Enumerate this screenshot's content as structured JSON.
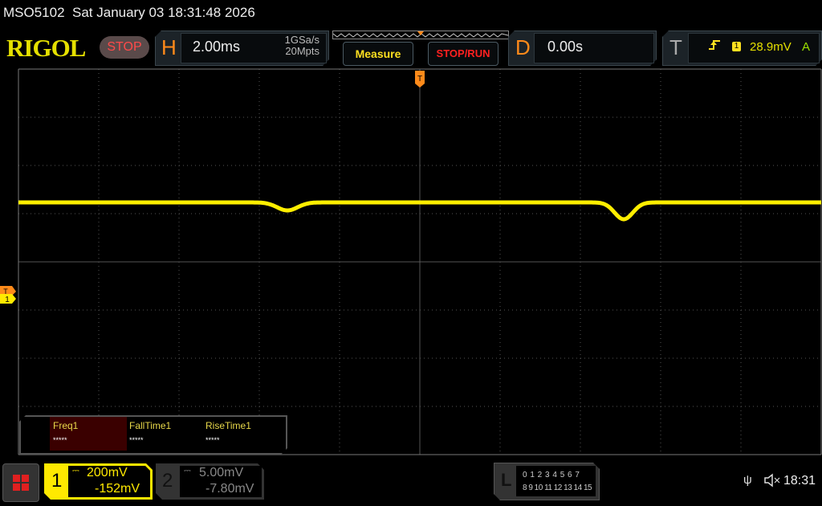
{
  "title_bar": {
    "model": "MSO5102",
    "datetime": "Sat January 03 18:31:48 2026"
  },
  "brand": {
    "logo": "RIGOL",
    "run_state": "STOP"
  },
  "horizontal": {
    "letter": "H",
    "scale": "2.00ms",
    "sample_rate": "1GSa/s",
    "memory_depth": "20Mpts"
  },
  "buttons": {
    "measure": "Measure",
    "stop_run": "STOP/RUN"
  },
  "delay": {
    "letter": "D",
    "value": "0.00s"
  },
  "trigger": {
    "letter": "T",
    "edge_icon": "rising-edge-icon",
    "source": "1",
    "level": "28.9mV",
    "mode": "A"
  },
  "markers": {
    "trigger_position": "T",
    "ch1_level": "T",
    "ch1_ground": "1"
  },
  "measurements": [
    {
      "label": "Freq1",
      "value": "*****"
    },
    {
      "label": "FallTime1",
      "value": "*****"
    },
    {
      "label": "RiseTime1",
      "value": "*****"
    }
  ],
  "channels": [
    {
      "number": "1",
      "scale": "200mV",
      "offset": "-152mV",
      "color": "#ffe900",
      "active": true
    },
    {
      "number": "2",
      "scale": "5.00mV",
      "offset": "-7.80mV",
      "color": "#888888",
      "active": false
    }
  ],
  "logic": {
    "letter": "L",
    "row1": "0 1 2 3  4 5 6 7",
    "row2": "8 9 10 11 12 13 14 15"
  },
  "status": {
    "usb_icon": "usb-icon",
    "sound_icon": "speaker-muted-icon",
    "time": "18:31"
  },
  "waveform_color": "#ffee00"
}
